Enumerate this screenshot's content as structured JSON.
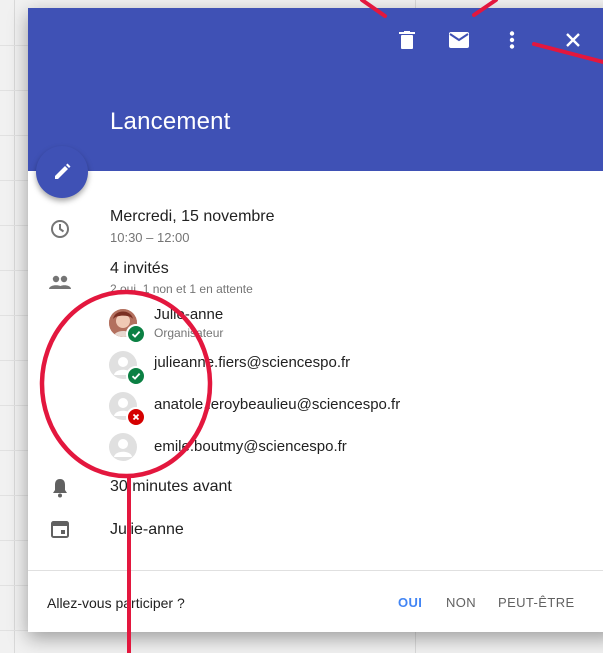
{
  "event": {
    "title": "Lancement",
    "date": "Mercredi, 15 novembre",
    "time": "10:30 – 12:00"
  },
  "guests": {
    "count_label": "4 invités",
    "summary": "2 oui, 1 non et 1 en attente",
    "list": [
      {
        "name": "Julie-anne",
        "role": "Organisateur",
        "status": "yes"
      },
      {
        "name": "julieanne.fiers@sciencespo.fr",
        "status": "yes"
      },
      {
        "name": "anatole.leroybeaulieu@sciencespo.fr",
        "status": "no"
      },
      {
        "name": "emile.boutmy@sciencespo.fr",
        "status": "pending"
      }
    ]
  },
  "reminder": "30 minutes avant",
  "calendar_owner": "Julie-anne",
  "rsvp": {
    "question": "Allez-vous participer ?",
    "yes": "OUI",
    "no": "NON",
    "maybe": "PEUT-ÊTRE"
  },
  "colors": {
    "header": "#3f51b5",
    "accent_blue": "#4285f4",
    "status_yes": "#0b8043",
    "status_no": "#d50000",
    "annotation": "#e3173e"
  },
  "icons": {
    "toolbar": [
      "delete-icon",
      "email-icon",
      "more-vert-icon",
      "close-icon"
    ],
    "fab": "edit-icon",
    "rows": [
      "clock-icon",
      "people-icon",
      "bell-icon",
      "calendar-icon"
    ]
  }
}
